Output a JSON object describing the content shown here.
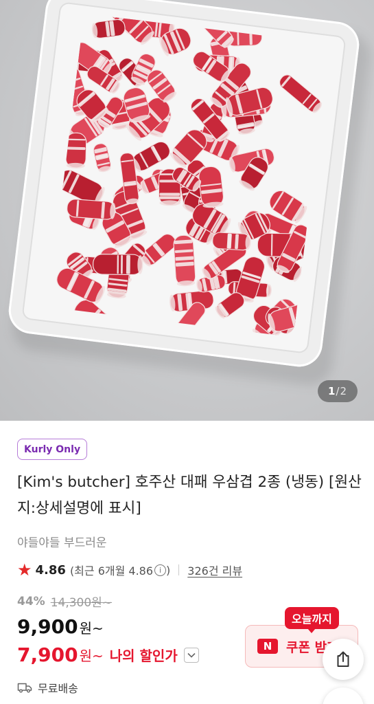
{
  "gallery": {
    "image_alt": "product-photo-beef-brisket-rolls-on-tray",
    "current": "1",
    "total": "2",
    "separator": "/"
  },
  "product": {
    "badge": "Kurly Only",
    "title": "[Kim's butcher] 호주산 대패 우삼겹 2종 (냉동) [원산지:상세설명에 표시]",
    "subtitle": "야들야들 부드러운"
  },
  "rating": {
    "score": "4.86",
    "recent_label": "(최근 6개월 4.86",
    "recent_close": ")",
    "review_count": "326건 리뷰"
  },
  "pricing": {
    "discount_rate": "44%",
    "original_price": "14,300원~",
    "price": "9,900",
    "price_unit": "원~",
    "member_price": "7,900",
    "member_unit": "원~",
    "member_label": "나의 할인가"
  },
  "coupon": {
    "tooltip": "오늘까지",
    "pay_logo": "N",
    "label": "쿠폰 받기"
  },
  "shipping": {
    "label": "무료배송"
  },
  "colors": {
    "accent_red": "#e5162e",
    "kurly_purple": "#5f0080",
    "star": "#e42a2a"
  },
  "icons": [
    "star-icon",
    "info-icon",
    "chevron-down-icon",
    "truck-icon",
    "share-icon"
  ]
}
